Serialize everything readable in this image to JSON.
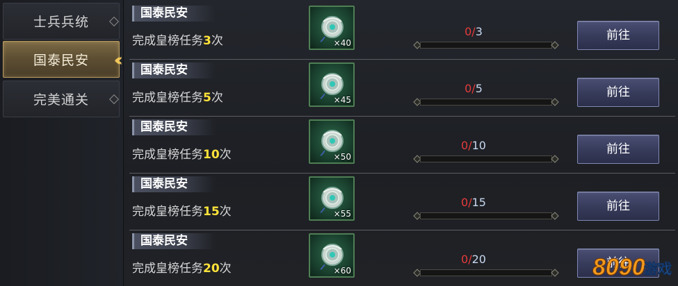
{
  "sidebar": {
    "tabs": [
      {
        "label": "士兵兵统",
        "active": false
      },
      {
        "label": "国泰民安",
        "active": true
      },
      {
        "label": "完美通关",
        "active": false
      }
    ]
  },
  "rows": [
    {
      "title": "国泰民安",
      "desc_prefix": "完成皇榜任务",
      "count": "3",
      "desc_suffix": "次",
      "reward_qty": "×40",
      "progress_current": "0",
      "progress_sep": "/",
      "progress_total": "3",
      "button": "前往"
    },
    {
      "title": "国泰民安",
      "desc_prefix": "完成皇榜任务",
      "count": "5",
      "desc_suffix": "次",
      "reward_qty": "×45",
      "progress_current": "0",
      "progress_sep": "/",
      "progress_total": "5",
      "button": "前往"
    },
    {
      "title": "国泰民安",
      "desc_prefix": "完成皇榜任务",
      "count": "10",
      "desc_suffix": "次",
      "reward_qty": "×50",
      "progress_current": "0",
      "progress_sep": "/",
      "progress_total": "10",
      "button": "前往"
    },
    {
      "title": "国泰民安",
      "desc_prefix": "完成皇榜任务",
      "count": "15",
      "desc_suffix": "次",
      "reward_qty": "×55",
      "progress_current": "0",
      "progress_sep": "/",
      "progress_total": "15",
      "button": "前往"
    },
    {
      "title": "国泰民安",
      "desc_prefix": "完成皇榜任务",
      "count": "20",
      "desc_suffix": "次",
      "reward_qty": "×60",
      "progress_current": "0",
      "progress_sep": "/",
      "progress_total": "20",
      "button": "前往"
    }
  ],
  "watermark": {
    "text": "8090",
    "suffix": "游戏"
  },
  "colors": {
    "highlight_number": "#ffe23a",
    "progress_current": "#e53b3b",
    "active_tab_gold": "#b89a5e",
    "button_blue": "#383c5c"
  }
}
